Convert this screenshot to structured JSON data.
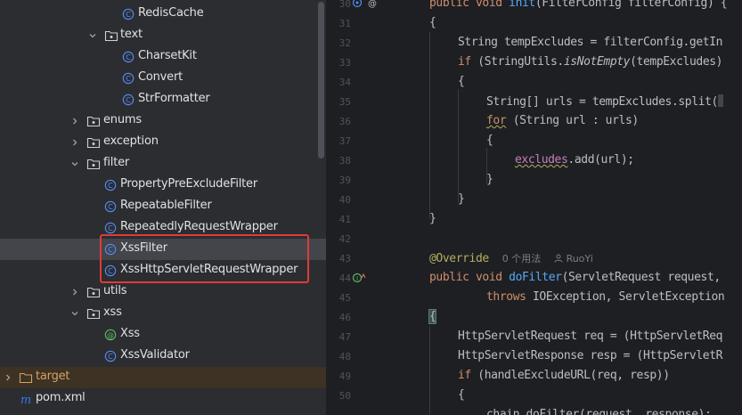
{
  "tree": {
    "items": [
      {
        "label": "RedisCache",
        "kind": "class"
      },
      {
        "label": "text",
        "kind": "folder",
        "expanded": true
      },
      {
        "label": "CharsetKit",
        "kind": "class"
      },
      {
        "label": "Convert",
        "kind": "class"
      },
      {
        "label": "StrFormatter",
        "kind": "class"
      },
      {
        "label": "enums",
        "kind": "folder",
        "expanded": false
      },
      {
        "label": "exception",
        "kind": "folder",
        "expanded": false
      },
      {
        "label": "filter",
        "kind": "folder",
        "expanded": true
      },
      {
        "label": "PropertyPreExcludeFilter",
        "kind": "class"
      },
      {
        "label": "RepeatableFilter",
        "kind": "class"
      },
      {
        "label": "RepeatedlyRequestWrapper",
        "kind": "class"
      },
      {
        "label": "XssFilter",
        "kind": "class",
        "selected": true
      },
      {
        "label": "XssHttpServletRequestWrapper",
        "kind": "class"
      },
      {
        "label": "utils",
        "kind": "folder",
        "expanded": false
      },
      {
        "label": "xss",
        "kind": "folder",
        "expanded": true
      },
      {
        "label": "Xss",
        "kind": "annotation"
      },
      {
        "label": "XssValidator",
        "kind": "class"
      },
      {
        "label": "target",
        "kind": "folder-plain",
        "expanded": false
      },
      {
        "label": "pom.xml",
        "kind": "maven"
      }
    ]
  },
  "editor": {
    "line_numbers": [
      "30",
      "31",
      "32",
      "33",
      "34",
      "35",
      "36",
      "37",
      "38",
      "39",
      "40",
      "41",
      "42",
      "43",
      "44",
      "45",
      "46",
      "47",
      "48",
      "49",
      "50"
    ],
    "code": {
      "l30_kw1": "public",
      "l30_kw2": "void",
      "l30_fn": "init",
      "l30_rest": "(FilterConfig filterConfig) {",
      "l31": "{",
      "l32": "String tempExcludes = filterConfig.getIn",
      "l33_kw": "if",
      "l33_a": " (StringUtils.",
      "l33_it": "isNotEmpty",
      "l33_b": "(tempExcludes)",
      "l34": "{",
      "l35_a": "String[] urls = tempExcludes.split(",
      "l36_kw": "for",
      "l36_rest": " (String url : urls)",
      "l37": "{",
      "l38_fld": "excludes",
      "l38_rest": ".add(url);",
      "l39": "}",
      "l40": "}",
      "l41": "}",
      "l43_ann": "@Override",
      "l43_usages": "0 个用法",
      "l43_author": "RuoYi",
      "l44_kw1": "public",
      "l44_kw2": "void",
      "l44_fn": "doFilter",
      "l44_rest": "(ServletRequest request,",
      "l45_kw": "throws",
      "l45_rest": " IOException, ServletException",
      "l46": "{",
      "l47": "HttpServletRequest req = (HttpServletReq",
      "l48": "HttpServletResponse resp = (HttpServletR",
      "l49_kw": "if",
      "l49_rest": " (handleExcludeURL(req, resp))",
      "l50": "{",
      "l51": "chain.doFilter(request, response);"
    }
  },
  "colors": {
    "class_icon": "#548af7",
    "folder_icon": "#ced0d6",
    "highlight_box": "#e03a3a",
    "annotation_icon": "#5fb865",
    "maven_icon": "#3574f0"
  }
}
